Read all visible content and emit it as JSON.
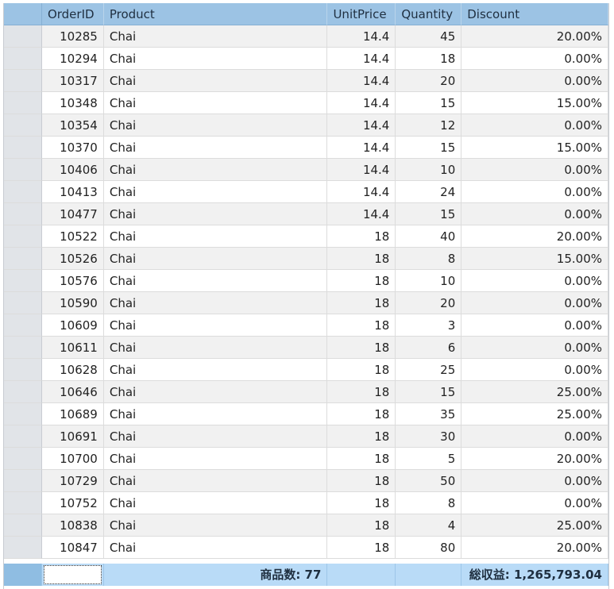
{
  "table": {
    "columns": [
      "OrderID",
      "Product",
      "UnitPrice",
      "Quantity",
      "Discount"
    ],
    "rows": [
      [
        "10285",
        "Chai",
        "14.4",
        "45",
        "20.00%"
      ],
      [
        "10294",
        "Chai",
        "14.4",
        "18",
        "0.00%"
      ],
      [
        "10317",
        "Chai",
        "14.4",
        "20",
        "0.00%"
      ],
      [
        "10348",
        "Chai",
        "14.4",
        "15",
        "15.00%"
      ],
      [
        "10354",
        "Chai",
        "14.4",
        "12",
        "0.00%"
      ],
      [
        "10370",
        "Chai",
        "14.4",
        "15",
        "15.00%"
      ],
      [
        "10406",
        "Chai",
        "14.4",
        "10",
        "0.00%"
      ],
      [
        "10413",
        "Chai",
        "14.4",
        "24",
        "0.00%"
      ],
      [
        "10477",
        "Chai",
        "14.4",
        "15",
        "0.00%"
      ],
      [
        "10522",
        "Chai",
        "18",
        "40",
        "20.00%"
      ],
      [
        "10526",
        "Chai",
        "18",
        "8",
        "15.00%"
      ],
      [
        "10576",
        "Chai",
        "18",
        "10",
        "0.00%"
      ],
      [
        "10590",
        "Chai",
        "18",
        "20",
        "0.00%"
      ],
      [
        "10609",
        "Chai",
        "18",
        "3",
        "0.00%"
      ],
      [
        "10611",
        "Chai",
        "18",
        "6",
        "0.00%"
      ],
      [
        "10628",
        "Chai",
        "18",
        "25",
        "0.00%"
      ],
      [
        "10646",
        "Chai",
        "18",
        "15",
        "25.00%"
      ],
      [
        "10689",
        "Chai",
        "18",
        "35",
        "25.00%"
      ],
      [
        "10691",
        "Chai",
        "18",
        "30",
        "0.00%"
      ],
      [
        "10700",
        "Chai",
        "18",
        "5",
        "20.00%"
      ],
      [
        "10729",
        "Chai",
        "18",
        "50",
        "0.00%"
      ],
      [
        "10752",
        "Chai",
        "18",
        "8",
        "0.00%"
      ],
      [
        "10838",
        "Chai",
        "18",
        "4",
        "25.00%"
      ],
      [
        "10847",
        "Chai",
        "18",
        "80",
        "20.00%"
      ]
    ]
  },
  "footer": {
    "product_count": "商品数: 77",
    "total_revenue": "総収益: 1,265,793.04"
  },
  "colors": {
    "header_bg": "#9cc3e4",
    "footer_bg": "#b9dbf7",
    "alt_row_bg": "#f1f1f1"
  }
}
